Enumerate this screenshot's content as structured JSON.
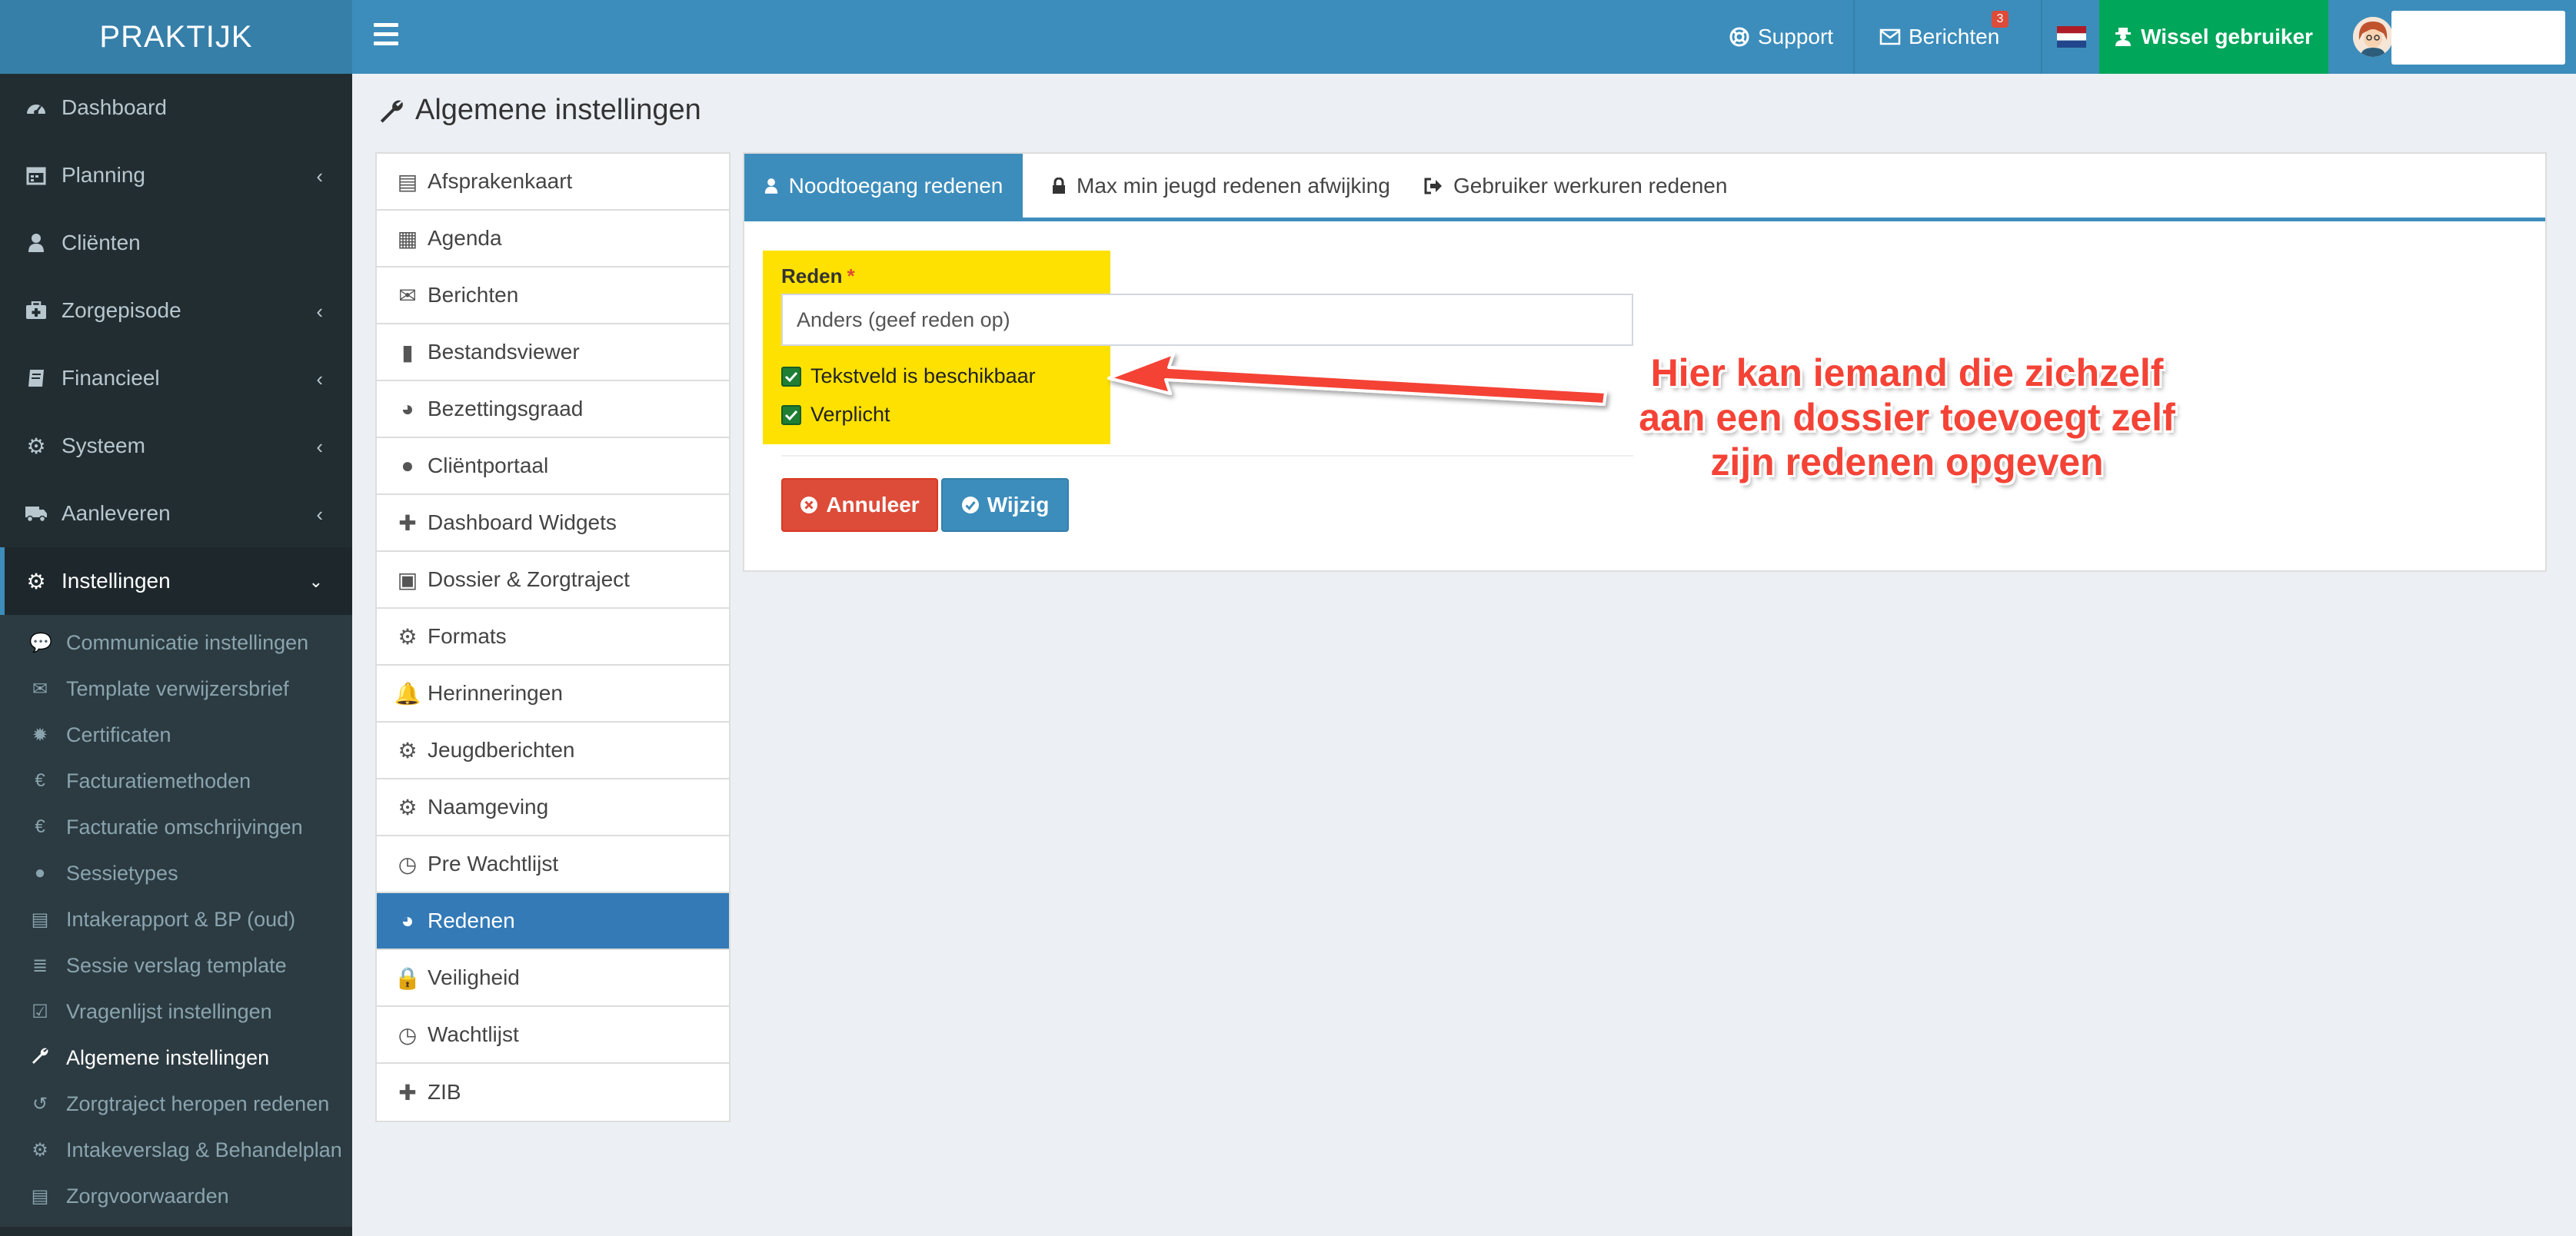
{
  "app": {
    "brand": "PRAKTIJK"
  },
  "sidebar": {
    "items": [
      {
        "label": "Dashboard",
        "icon": "dashboard-icon"
      },
      {
        "label": "Planning",
        "icon": "calendar-icon",
        "has_children": true
      },
      {
        "label": "Cliënten",
        "icon": "user-icon"
      },
      {
        "label": "Zorgepisode",
        "icon": "medkit-icon",
        "has_children": true
      },
      {
        "label": "Financieel",
        "icon": "book-icon",
        "has_children": true
      },
      {
        "label": "Systeem",
        "icon": "gears-icon",
        "has_children": true
      },
      {
        "label": "Aanleveren",
        "icon": "truck-icon",
        "has_children": true
      },
      {
        "label": "Instellingen",
        "icon": "gear-icon",
        "expanded": true
      }
    ],
    "submenu": [
      {
        "label": "Communicatie instellingen",
        "icon": "comments-icon",
        "glyph": "💬"
      },
      {
        "label": "Template verwijzersbrief",
        "icon": "envelope-icon",
        "glyph": "✉"
      },
      {
        "label": "Certificaten",
        "icon": "certificate-icon",
        "glyph": "✹"
      },
      {
        "label": "Facturatiemethoden",
        "icon": "euro-icon",
        "glyph": "€"
      },
      {
        "label": "Facturatie omschrijvingen",
        "icon": "euro-icon",
        "glyph": "€"
      },
      {
        "label": "Sessietypes",
        "icon": "globe-icon",
        "glyph": "●"
      },
      {
        "label": "Intakerapport & BP (oud)",
        "icon": "file-icon",
        "glyph": "▤"
      },
      {
        "label": "Sessie verslag template",
        "icon": "database-icon",
        "glyph": "≣"
      },
      {
        "label": "Vragenlijst instellingen",
        "icon": "check-square-icon",
        "glyph": "☑"
      },
      {
        "label": "Algemene instellingen",
        "icon": "wrench-icon",
        "glyph": "🔧",
        "current": true
      },
      {
        "label": "Zorgtraject heropen redenen",
        "icon": "undo-icon",
        "glyph": "↺"
      },
      {
        "label": "Intakeverslag & Behandelplan",
        "icon": "gear-icon",
        "glyph": "⚙"
      },
      {
        "label": "Zorgvoorwaarden",
        "icon": "file-icon",
        "glyph": "▤"
      }
    ]
  },
  "topbar": {
    "support": "Support",
    "berichten": "Berichten",
    "berichten_count": "3",
    "wissel": "Wissel gebruiker"
  },
  "page": {
    "title": "Algemene instellingen"
  },
  "settings_list": [
    {
      "label": "Afsprakenkaart",
      "icon": "list-alt-icon",
      "glyph": "▤"
    },
    {
      "label": "Agenda",
      "icon": "calendar-icon",
      "glyph": "▦"
    },
    {
      "label": "Berichten",
      "icon": "envelope-icon",
      "glyph": "✉"
    },
    {
      "label": "Bestandsviewer",
      "icon": "file-icon",
      "glyph": "▮"
    },
    {
      "label": "Bezettingsgraad",
      "icon": "pie-chart-icon",
      "glyph": "◕"
    },
    {
      "label": "Cliëntportaal",
      "icon": "globe-icon",
      "glyph": "●"
    },
    {
      "label": "Dashboard Widgets",
      "icon": "puzzle-icon",
      "glyph": "✚"
    },
    {
      "label": "Dossier & Zorgtraject",
      "icon": "medkit-icon",
      "glyph": "▣"
    },
    {
      "label": "Formats",
      "icon": "gear-icon",
      "glyph": "⚙"
    },
    {
      "label": "Herinneringen",
      "icon": "bell-icon",
      "glyph": "🔔"
    },
    {
      "label": "Jeugdberichten",
      "icon": "gear-icon",
      "glyph": "⚙"
    },
    {
      "label": "Naamgeving",
      "icon": "gear-icon",
      "glyph": "⚙"
    },
    {
      "label": "Pre Wachtlijst",
      "icon": "clock-icon",
      "glyph": "◷"
    },
    {
      "label": "Redenen",
      "icon": "pie-chart-icon",
      "glyph": "◕",
      "active": true
    },
    {
      "label": "Veiligheid",
      "icon": "lock-icon",
      "glyph": "🔒"
    },
    {
      "label": "Wachtlijst",
      "icon": "clock-icon",
      "glyph": "◷"
    },
    {
      "label": "ZIB",
      "icon": "puzzle-icon",
      "glyph": "✚"
    }
  ],
  "tabs": [
    {
      "label": "Noodtoegang redenen",
      "icon": "user-icon",
      "active": true
    },
    {
      "label": "Max min jeugd redenen afwijking",
      "icon": "lock-icon"
    },
    {
      "label": "Gebruiker werkuren redenen",
      "icon": "sign-out-icon"
    }
  ],
  "form": {
    "label": "Reden",
    "required_mark": "*",
    "value": "Anders (geef reden op)",
    "checkbox1": "Tekstveld is beschikbaar",
    "checkbox1_checked": true,
    "checkbox2": "Verplicht",
    "checkbox2_checked": true,
    "cancel": "Annuleer",
    "save": "Wijzig"
  },
  "annotation": {
    "line1": "Hier kan iemand die zichzelf",
    "line2": "aan een dossier toevoegt zelf",
    "line3": "zijn redenen opgeven"
  },
  "colors": {
    "sidebar": "#222d32",
    "topbar": "#3c8dbc",
    "accent": "#3c8dbc",
    "success": "#00a65a",
    "danger": "#dd4b39",
    "highlight": "#ffe100",
    "annotation": "#f44336"
  }
}
